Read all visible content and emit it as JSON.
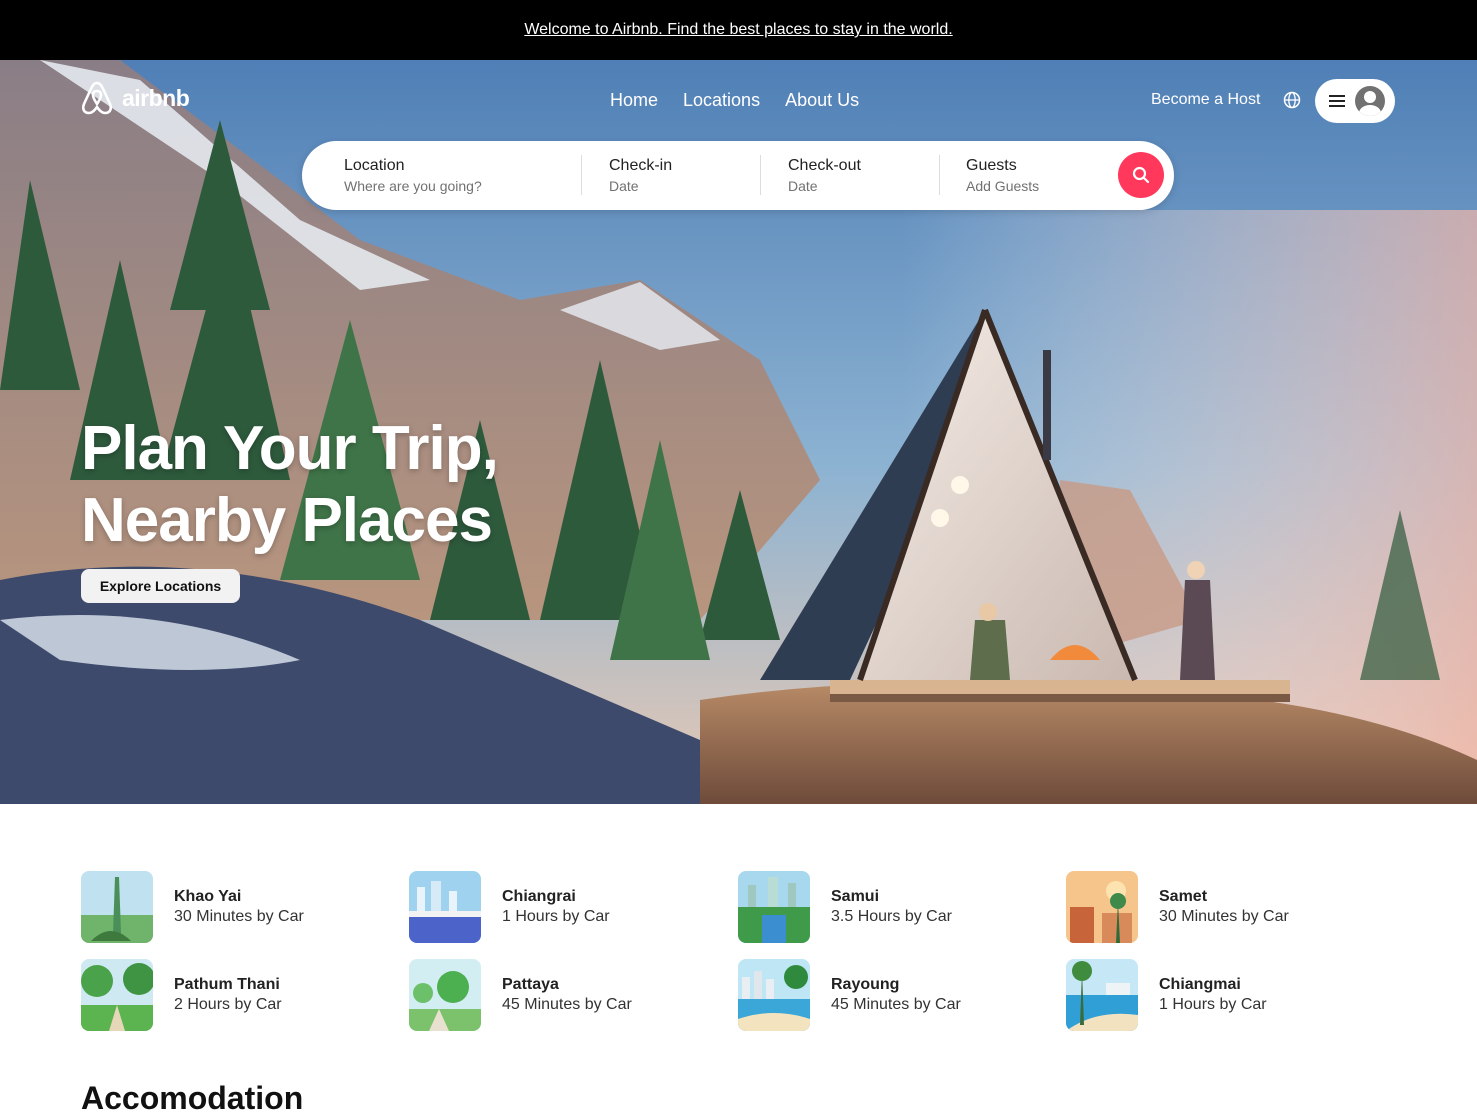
{
  "banner": {
    "text": "Welcome to Airbnb. Find the best places to stay in the world."
  },
  "header": {
    "brand": "airbnb",
    "nav": [
      "Home",
      "Locations",
      "About Us"
    ],
    "host_link": "Become a Host"
  },
  "search": {
    "location": {
      "label": "Location",
      "placeholder": "Where are you going?"
    },
    "checkin": {
      "label": "Check-in",
      "placeholder": "Date"
    },
    "checkout": {
      "label": "Check-out",
      "placeholder": "Date"
    },
    "guests": {
      "label": "Guests",
      "placeholder": "Add Guests"
    }
  },
  "hero": {
    "title_line1": "Plan Your Trip,",
    "title_line2": "Nearby Places",
    "cta": "Explore Locations"
  },
  "places": [
    {
      "name": "Khao Yai",
      "distance": "30 Minutes by Car"
    },
    {
      "name": "Chiangrai",
      "distance": "1 Hours by Car"
    },
    {
      "name": "Samui",
      "distance": "3.5 Hours by Car"
    },
    {
      "name": "Samet",
      "distance": "30 Minutes by Car"
    },
    {
      "name": "Pathum Thani",
      "distance": "2 Hours by Car"
    },
    {
      "name": "Pattaya",
      "distance": "45 Minutes by Car"
    },
    {
      "name": "Rayoung",
      "distance": "45 Minutes by Car"
    },
    {
      "name": "Chiangmai",
      "distance": "1 Hours by Car"
    }
  ],
  "section": {
    "title": "Accomodation"
  },
  "colors": {
    "brand": "#ff385c",
    "banner_bg": "#000000"
  }
}
